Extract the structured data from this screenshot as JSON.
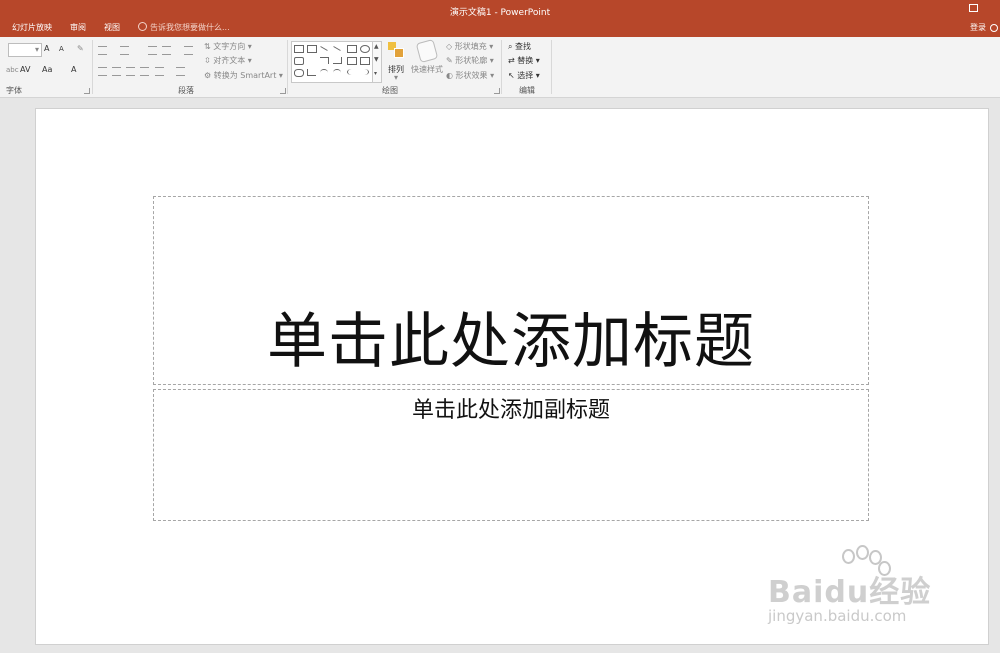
{
  "window": {
    "title": "演示文稿1 - PowerPoint",
    "login": "登录"
  },
  "menu": {
    "tabs": [
      "幻灯片放映",
      "审阅",
      "视图"
    ],
    "tell_me": "告诉我您想要做什么..."
  },
  "ribbon": {
    "groups": {
      "font": "字体",
      "paragraph": "段落",
      "drawing": "绘图",
      "editing": "编辑"
    },
    "paragraph": {
      "text_direction": "文字方向",
      "align_text": "对齐文本",
      "convert_smartart": "转换为 SmartArt"
    },
    "drawing": {
      "arrange": "排列",
      "quick_styles": "快速样式",
      "shape_fill": "形状填充",
      "shape_outline": "形状轮廓",
      "shape_effects": "形状效果"
    },
    "editing": {
      "find": "查找",
      "replace": "替换",
      "select": "选择"
    },
    "font": {
      "grow": "A",
      "shrink": "A",
      "case": "Aa",
      "color": "A",
      "spacing": "AV",
      "clear": "abc"
    }
  },
  "slide": {
    "title_placeholder": "单击此处添加标题",
    "subtitle_placeholder": "单击此处添加副标题"
  },
  "watermark": {
    "brand": "Baidu经验",
    "url": "jingyan.baidu.com"
  },
  "colors": {
    "accent": "#b7472a",
    "ribbon_bg": "#f3f3f3",
    "workspace_bg": "#e6e6e6"
  }
}
